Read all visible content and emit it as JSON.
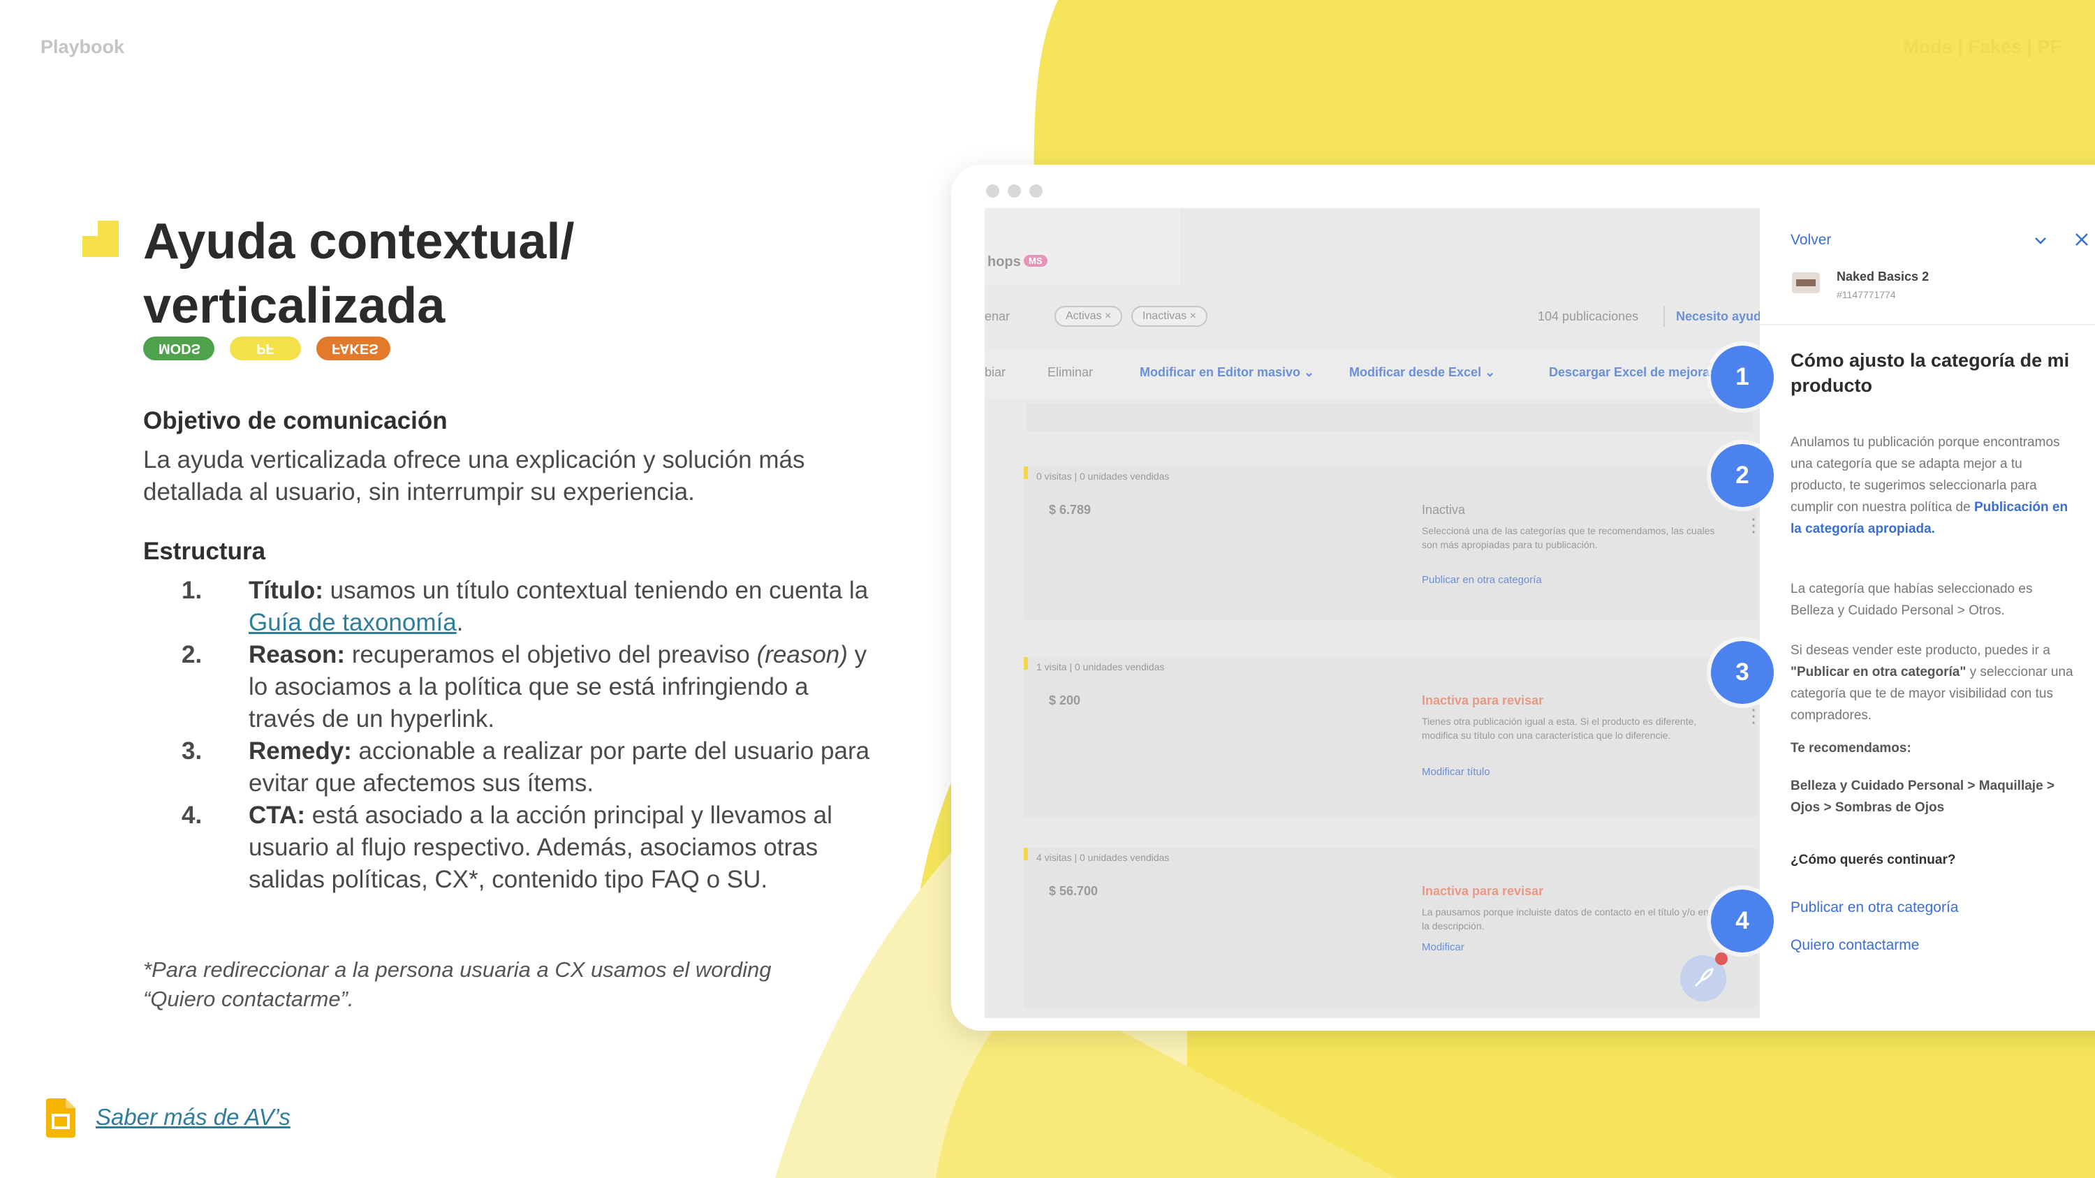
{
  "header": {
    "left_label": "Playbook",
    "right_label": "Mods | Fakes | PF"
  },
  "colors": {
    "accent_yellow": "#f6e55a",
    "badge_blue": "#4b82ee",
    "link_teal": "#2e7d9a",
    "tag_mods": "#4ea24b",
    "tag_pf": "#f4e04a",
    "tag_fakes": "#e3792a"
  },
  "title": {
    "line1": "Ayuda contextual/",
    "line2": "verticalizada"
  },
  "tags": [
    "MODS",
    "PF",
    "FAKES"
  ],
  "objective": {
    "heading": "Objetivo de comunicación",
    "text": "La ayuda verticalizada ofrece una explicación y solución más detallada al usuario, sin interrumpir su experiencia."
  },
  "structure": {
    "heading": "Estructura",
    "items": [
      {
        "num": "1.",
        "label": "Título:",
        "text_before": " usamos un título contextual teniendo en cuenta la ",
        "link": "Guía de taxonomía",
        "text_after": "."
      },
      {
        "num": "2.",
        "label": "Reason:",
        "text_before": " recuperamos el objetivo del preaviso ",
        "italic": "(reason)",
        "text_after": " y lo asociamos a la política que se está infringiendo a través de un hyperlink."
      },
      {
        "num": "3.",
        "label": "Remedy:",
        "text_before": " accionable a realizar por parte del usuario para evitar que afectemos sus ítems."
      },
      {
        "num": "4.",
        "label": "CTA:",
        "text_before": " está asociado a la acción principal y llevamos al usuario al flujo respectivo. Además, asociamos otras salidas políticas, CX*, contenido tipo FAQ o SU."
      }
    ]
  },
  "footnote": {
    "line1": "*Para redireccionar a la persona usuaria a CX usamos el wording",
    "line2": "“Quiero contactarme”."
  },
  "footer_link": {
    "icon": "slides-icon",
    "label": "Saber más de AV’s"
  },
  "mock": {
    "tab_label": "hops",
    "tab_badge": "MS",
    "order_label": "enar",
    "filters": [
      "Activas ×",
      "Inactivas ×"
    ],
    "count": "104 publicaciones",
    "help": "Necesito ayuda",
    "actions": [
      "biar",
      "Eliminar",
      "Modificar en Editor masivo ⌄",
      "Modificar desde Excel ⌄",
      "Descargar Excel de mejoras"
    ],
    "cards": [
      {
        "stats": "0 visitas | 0 unidades vendidas",
        "price": "$ 6.789",
        "status": "Inactiva",
        "desc": "Seleccioná una de las categorías que te recomendamos, las cuales son más apropiadas para tu publicación.",
        "link": "Publicar en otra categoría"
      },
      {
        "stats": "1 visita | 0 unidades vendidas",
        "price": "$ 200",
        "status": "Inactiva para revisar",
        "desc": "Tienes otra publicación igual a esta. Si el producto es diferente, modifica su título con una característica que lo diferencie.",
        "link": "Modificar título"
      },
      {
        "stats": "4 visitas | 0 unidades vendidas",
        "price": "$ 56.700",
        "status": "Inactiva para revisar",
        "desc": "La pausamos porque incluiste datos de contacto en el título y/o en la descripción.",
        "link": "Modificar"
      }
    ],
    "panel": {
      "back": "Volver",
      "product_name": "Naked Basics 2",
      "product_id": "#1147771774",
      "title": "Cómo ajusto la categoría de mi producto",
      "reason_text": "Anulamos tu publicación porque encontramos una categoría que se adapta mejor a tu producto, te sugerimos seleccionarla para cumplir con nuestra política de ",
      "reason_link": "Publicación en la categoría apropiada.",
      "prev_category": "La categoría que habías seleccionado es Belleza y Cuidado Personal > Otros.",
      "remedy_a": "Si deseas vender este producto, puedes ir a ",
      "remedy_b": "\"Publicar en otra categoría\"",
      "remedy_c": " y seleccionar una categoría que te de mayor visibilidad con tus compradores.",
      "recommend_label": "Te recomendamos:",
      "recommend_value": "Belleza y Cuidado Personal > Maquillaje > Ojos > Sombras de Ojos",
      "question": "¿Cómo querés continuar?",
      "cta_primary": "Publicar en otra categoría",
      "cta_secondary": "Quiero contactarme"
    },
    "badges": [
      "1",
      "2",
      "3",
      "4"
    ]
  }
}
